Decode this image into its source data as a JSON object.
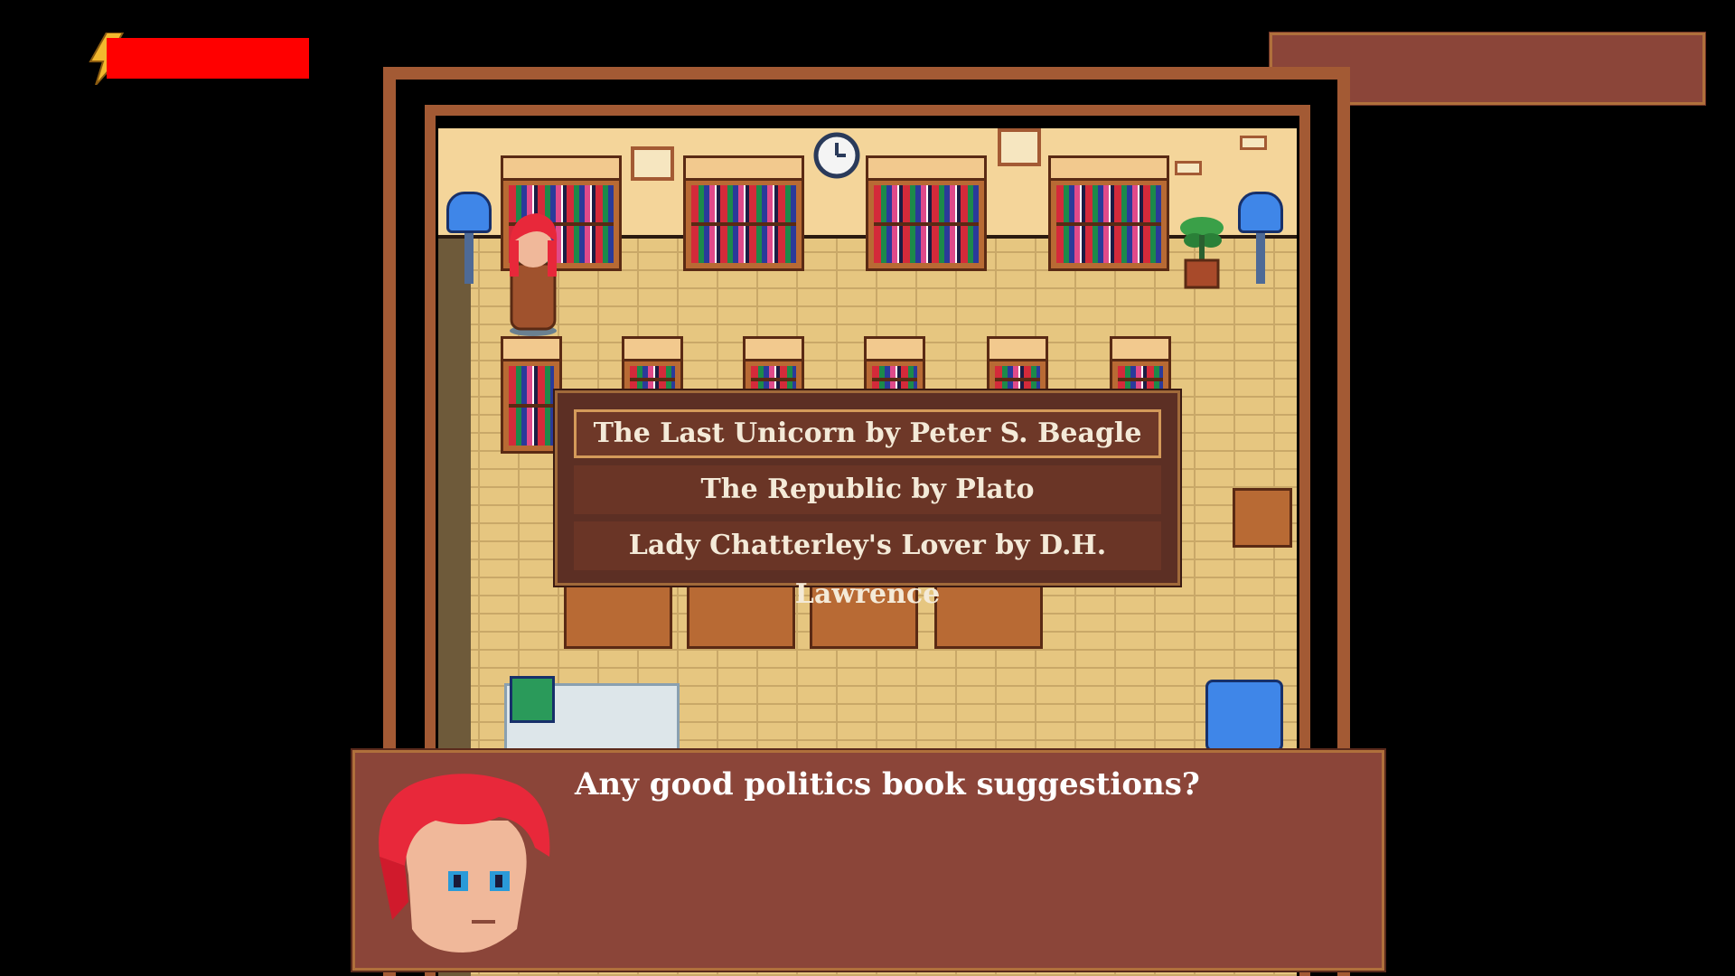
{
  "hud": {
    "energy_icon": "lightning-bolt-icon",
    "energy_bar_color": "#ff0000",
    "energy_level": 1.0
  },
  "menu": {
    "options": [
      {
        "label": "The Last Unicorn by Peter S. Beagle",
        "selected": true
      },
      {
        "label": "The Republic by Plato",
        "selected": false
      },
      {
        "label": "Lady Chatterley's Lover by D.H. Lawrence",
        "selected": false
      }
    ]
  },
  "dialog": {
    "text": "Any good politics book suggestions?",
    "portrait": "red-haired-character-portrait"
  },
  "colors": {
    "panel": "#8b4539",
    "menu_bg": "#5c2f24",
    "menu_highlight": "#d49a5a",
    "floor": "#e6c680",
    "wall_trim": "#a35a34"
  }
}
